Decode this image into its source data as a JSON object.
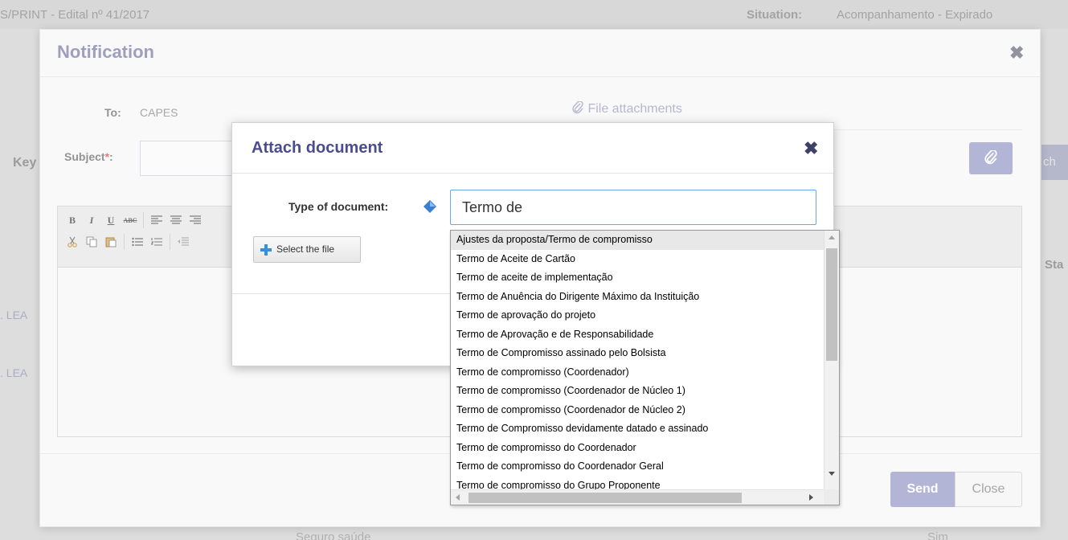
{
  "background": {
    "edital": "S/PRINT - Edital nº 41/2017",
    "situation_label": "Situation:",
    "situation_value": "Acompanhamento - Expirado",
    "key_label": "Key",
    "search_fragment": "ch",
    "status_fragment": "Sta",
    "row1_fragment": ". LEA",
    "row2_fragment": ". LEA",
    "bottom_left": "Seguro saúde",
    "bottom_right": "Sim"
  },
  "notification": {
    "title": "Notification",
    "to_label": "To:",
    "to_value": "CAPES",
    "file_attachments": "File attachments",
    "subject_label": "Subject",
    "subject_required": "*",
    "subject_colon": ":",
    "subject_value": "",
    "toolbar": {
      "bold": "B",
      "italic": "I",
      "underline": "U",
      "strike": "ABC"
    },
    "send_label": "Send",
    "close_label": "Close"
  },
  "attach_dialog": {
    "title": "Attach document",
    "type_label": "Type of document:",
    "type_value": "Termo de",
    "select_file_label": "Select the file"
  },
  "dropdown": {
    "selected_index": 0,
    "items": [
      "Ajustes da proposta/Termo de compromisso",
      "Termo de Aceite de Cartão",
      "Termo de aceite de implementação",
      "Termo de Anuência do Dirigente Máximo da Instituição",
      "Termo de aprovação do projeto",
      "Termo de Aprovação e de Responsabilidade",
      "Termo de Compromisso assinado pelo Bolsista",
      "Termo de compromisso (Coordenador)",
      "Termo de compromisso (Coordenador de Núcleo 1)",
      "Termo de compromisso (Coordenador de Núcleo 2)",
      "Termo de Compromisso devidamente datado e assinado",
      "Termo de compromisso do Coordenador",
      "Termo de compromisso do Coordenador Geral",
      "Termo de compromisso do Grupo Proponente"
    ]
  },
  "colors": {
    "accent": "#9a9dc9",
    "title_blue": "#4a4c8c",
    "required": "#d9534f"
  }
}
